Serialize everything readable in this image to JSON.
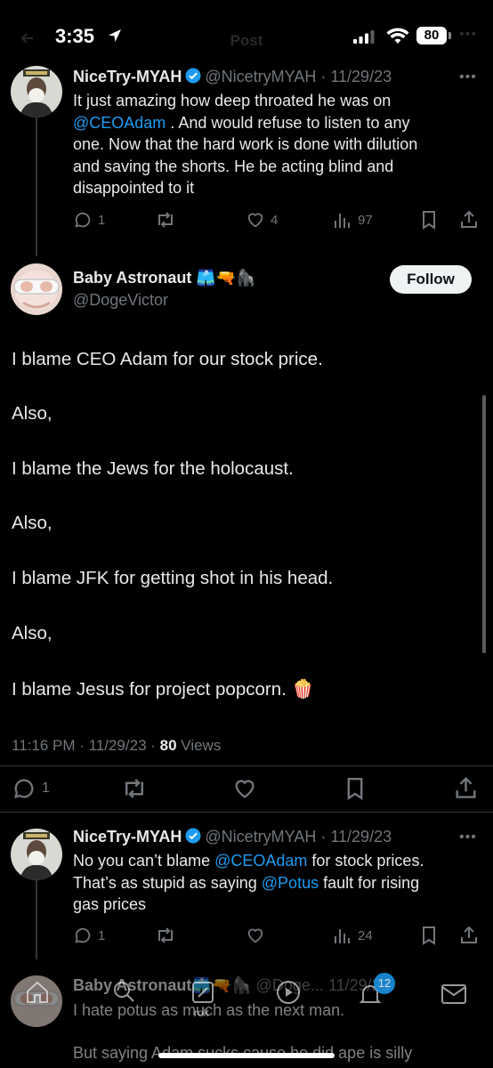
{
  "status_bar": {
    "time": "3:35",
    "battery": "80"
  },
  "header": {
    "title": "Post"
  },
  "tweets": [
    {
      "name": "NiceTry-MYAH",
      "handle": "@NicetryMYAH",
      "date": "· 11/29/23",
      "body": [
        "It just amazing how deep throated he was on",
        "@CEOAdam",
        " . And would refuse to listen to any",
        "one. Now that the hard work is done with dilution",
        "and saving the shorts. He be acting blind and",
        "disappointed to it"
      ],
      "replies": "1",
      "likes": "4",
      "views": "97"
    },
    {
      "name": "NiceTry-MYAH",
      "handle": "@NicetryMYAH",
      "date": "· 11/29/23",
      "body": [
        "No you can’t blame ",
        "@CEOAdam",
        " for stock prices.",
        "That’s as stupid as saying ",
        "@Potus",
        " fault for rising",
        "gas prices"
      ],
      "replies": "1",
      "views": "24"
    }
  ],
  "main_tweet": {
    "name": "Baby Astronaut",
    "name_emojis": "🩳🔫🦍",
    "handle": "@DogeVictor",
    "follow_label": "Follow",
    "lines": [
      "I blame CEO Adam for our stock price.",
      "Also,",
      "I blame the Jews for the holocaust.",
      "Also,",
      "I blame JFK for getting shot in his head.",
      "Also,",
      "I blame Jesus for project popcorn."
    ],
    "popcorn_emoji": "🍿",
    "time": "11:16 PM · 11/29/23 · ",
    "views_count": "80",
    "views_label": " Views",
    "replies": "1"
  },
  "bottom_tweet": {
    "name": "Baby Astronaut",
    "emojis": "🩳🔫🦍",
    "handle": "@Doge...",
    "date": "11/29/23",
    "line1": "I hate potus as much as the next man.",
    "line2": "But saying Adam sucks cause he did ape is silly"
  },
  "nav": {
    "notif_count": "12",
    "grok_label": "rok"
  },
  "colors": {
    "accent": "#1d9bf0",
    "background": "#000000",
    "text": "#e7e9ea",
    "muted": "#71767b"
  }
}
